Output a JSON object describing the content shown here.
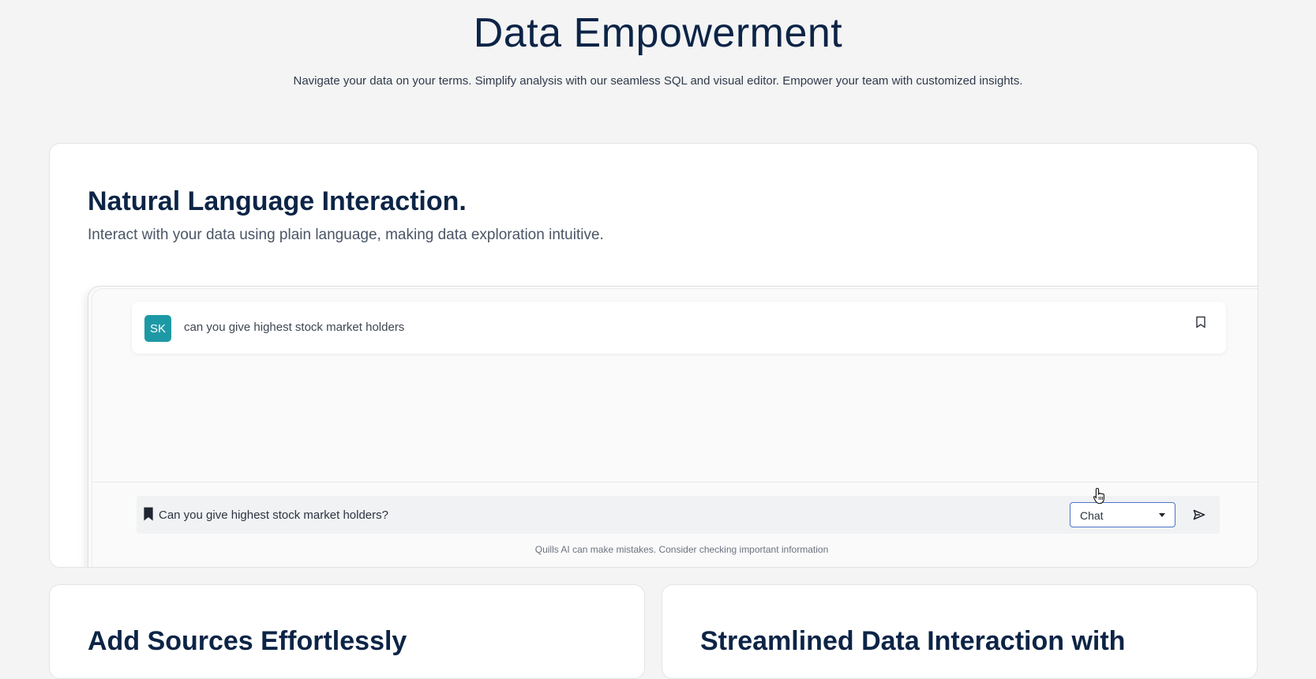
{
  "hero": {
    "title": "Data Empowerment",
    "subtitle": "Navigate your data on your terms. Simplify analysis with our seamless SQL and visual editor. Empower your team with customized insights."
  },
  "feature": {
    "title": "Natural Language Interaction.",
    "subtitle": "Interact with your data using plain language, making data exploration intuitive.",
    "demo": {
      "avatar_initials": "SK",
      "avatar_color": "#1d99a5",
      "message": "can you give highest stock market holders",
      "input_value": "Can you give highest stock market holders?",
      "mode_selected": "Chat",
      "disclaimer": "Quills AI can make mistakes. Consider checking important information",
      "icons": {
        "message_bookmark": "bookmark-outline-icon",
        "input_bookmark": "bookmark-filled-icon",
        "dropdown": "caret-down-icon",
        "send": "send-icon",
        "cursor": "hand-pointer-cursor-icon"
      }
    }
  },
  "cards": [
    {
      "title": "Add Sources Effortlessly"
    },
    {
      "title": "Streamlined Data Interaction with"
    }
  ],
  "colors": {
    "page_background": "#f4f4f5",
    "heading": "#0c2446",
    "select_border": "#4a74c9"
  }
}
